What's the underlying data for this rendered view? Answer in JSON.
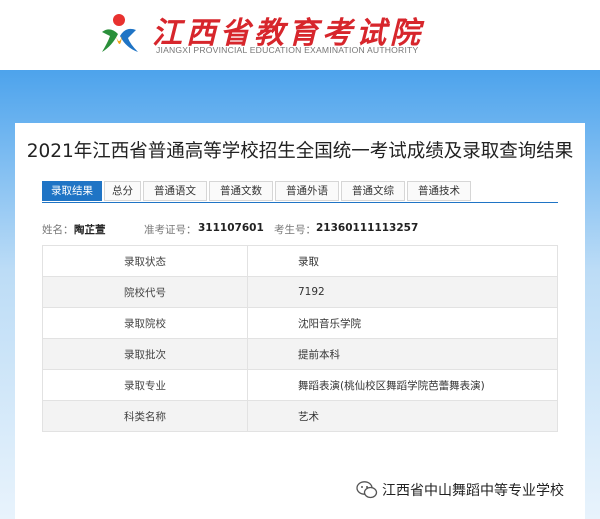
{
  "header": {
    "logo_title": "江西省教育考试院",
    "logo_subtitle": "JIANGXI PROVINCIAL EDUCATION EXAMINATION AUTHORITY"
  },
  "page": {
    "title": "2021年江西省普通高等学校招生全国统一考试成绩及录取查询结果"
  },
  "tabs": [
    {
      "label": "录取结果",
      "active": true
    },
    {
      "label": "总分",
      "active": false
    },
    {
      "label": "普通语文",
      "active": false
    },
    {
      "label": "普通文数",
      "active": false
    },
    {
      "label": "普通外语",
      "active": false
    },
    {
      "label": "普通文综",
      "active": false
    },
    {
      "label": "普通技术",
      "active": false
    }
  ],
  "student": {
    "name_label": "姓名：",
    "name": "陶芷萱",
    "ticket_label": "准考证号：",
    "ticket": "311107601",
    "exam_label": "考生号：",
    "exam_no": "21360111113257"
  },
  "results": [
    {
      "key": "录取状态",
      "value": "录取"
    },
    {
      "key": "院校代号",
      "value": "7192"
    },
    {
      "key": "录取院校",
      "value": "沈阳音乐学院"
    },
    {
      "key": "录取批次",
      "value": "提前本科"
    },
    {
      "key": "录取专业",
      "value": "舞蹈表演(桃仙校区舞蹈学院芭蕾舞表演)"
    },
    {
      "key": "科类名称",
      "value": "艺术"
    }
  ],
  "watermark": {
    "text": "江西省中山舞蹈中等专业学校",
    "icon": "wechat-icon"
  },
  "colors": {
    "accent": "#1f74c5",
    "logo_red": "#d7262c",
    "band_top": "#4da3ec"
  }
}
